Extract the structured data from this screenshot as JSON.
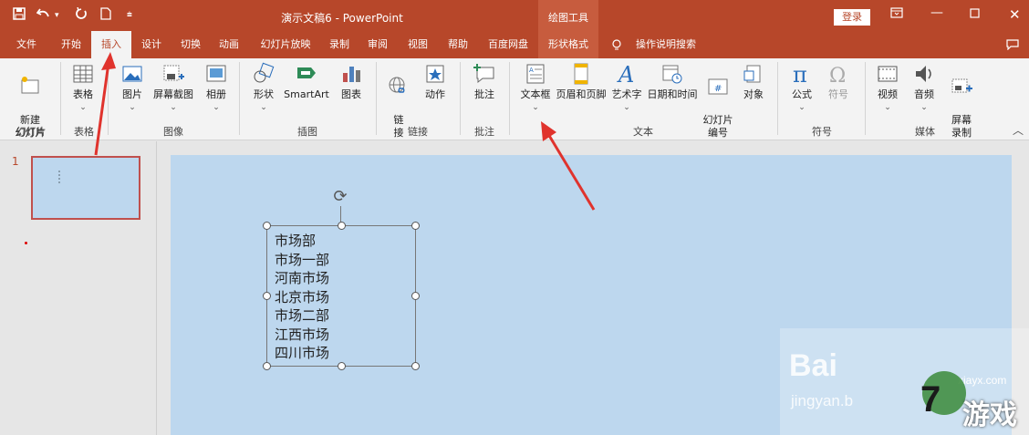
{
  "titlebar": {
    "title": "演示文稿6 - PowerPoint",
    "context_group": "绘图工具",
    "login_label": "登录",
    "quick_access_icons": [
      "save-icon",
      "undo-icon",
      "redo-icon",
      "new-file-icon",
      "customize-icon"
    ]
  },
  "tabs": [
    {
      "label": "文件"
    },
    {
      "label": "开始"
    },
    {
      "label": "插入"
    },
    {
      "label": "设计"
    },
    {
      "label": "切换"
    },
    {
      "label": "动画"
    },
    {
      "label": "幻灯片放映"
    },
    {
      "label": "录制"
    },
    {
      "label": "审阅"
    },
    {
      "label": "视图"
    },
    {
      "label": "帮助"
    },
    {
      "label": "百度网盘"
    },
    {
      "label": "形状格式"
    },
    {
      "label": "操作说明搜索"
    }
  ],
  "ribbon": {
    "new_slide": "新建\n幻灯片",
    "table": "表格",
    "picture": "图片",
    "screenshot": "屏幕截图",
    "album": "相册",
    "shapes": "形状",
    "smartart": "SmartArt",
    "chart": "图表",
    "link": "链\n接",
    "action": "动作",
    "comment": "批注",
    "textbox": "文本框",
    "header_footer": "页眉和页脚",
    "wordart": "艺术字",
    "datetime": "日期和时间",
    "slide_number": "幻灯片\n编号",
    "object": "对象",
    "equation": "公式",
    "symbol": "符号",
    "video": "视频",
    "audio": "音频",
    "screen_record": "屏幕\n录制",
    "groups": {
      "slides": "幻灯片",
      "tables": "表格",
      "images": "图像",
      "illustrations": "插图",
      "links": "链接",
      "comments": "批注",
      "text": "文本",
      "symbols": "符号",
      "media": "媒体"
    }
  },
  "thumbnails": {
    "slide_number": "1"
  },
  "textbox_lines": [
    "市场部",
    "市场一部",
    "河南市场",
    "北京市场",
    "市场二部",
    "江西市场",
    "四川市场"
  ],
  "watermark": {
    "text1": "Bai",
    "text2": "jingyan.b",
    "site": "xiayx.com",
    "game": "游戏"
  },
  "colors": {
    "accent": "#b7472a",
    "slide_bg": "#bdd7ee"
  }
}
